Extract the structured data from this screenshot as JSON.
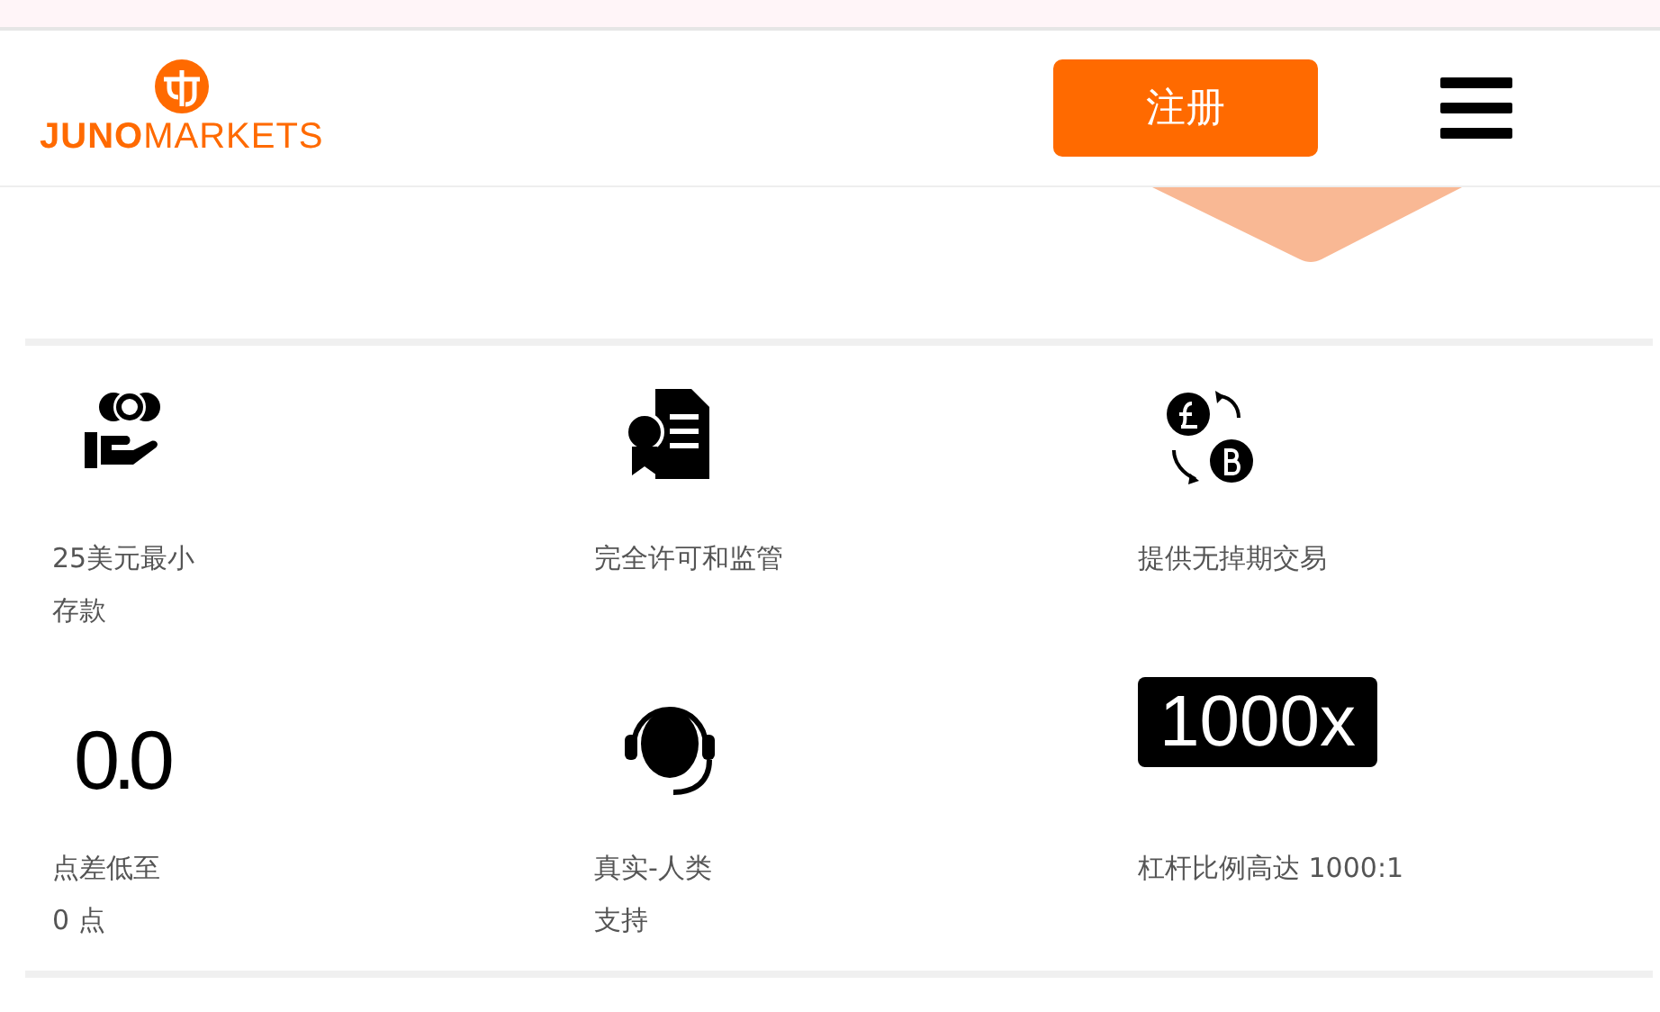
{
  "header": {
    "logo": {
      "strong": "JUNO",
      "light": "MARKETS"
    },
    "register_button": "注册"
  },
  "features": [
    {
      "kind": "money",
      "lines": [
        "25美元最小",
        "存款"
      ]
    },
    {
      "kind": "certificate",
      "lines": [
        "完全许可和监管"
      ]
    },
    {
      "kind": "exchange",
      "lines": [
        "提供无掉期交易"
      ]
    },
    {
      "kind": "numeral",
      "mark": "0.0",
      "lines": [
        "点差低至",
        "0 点"
      ]
    },
    {
      "kind": "headset",
      "lines": [
        "真实-人类",
        "支持"
      ]
    },
    {
      "kind": "badge",
      "mark": "1000x",
      "lines": [
        "杠杆比例高达 1000:1"
      ]
    }
  ]
}
